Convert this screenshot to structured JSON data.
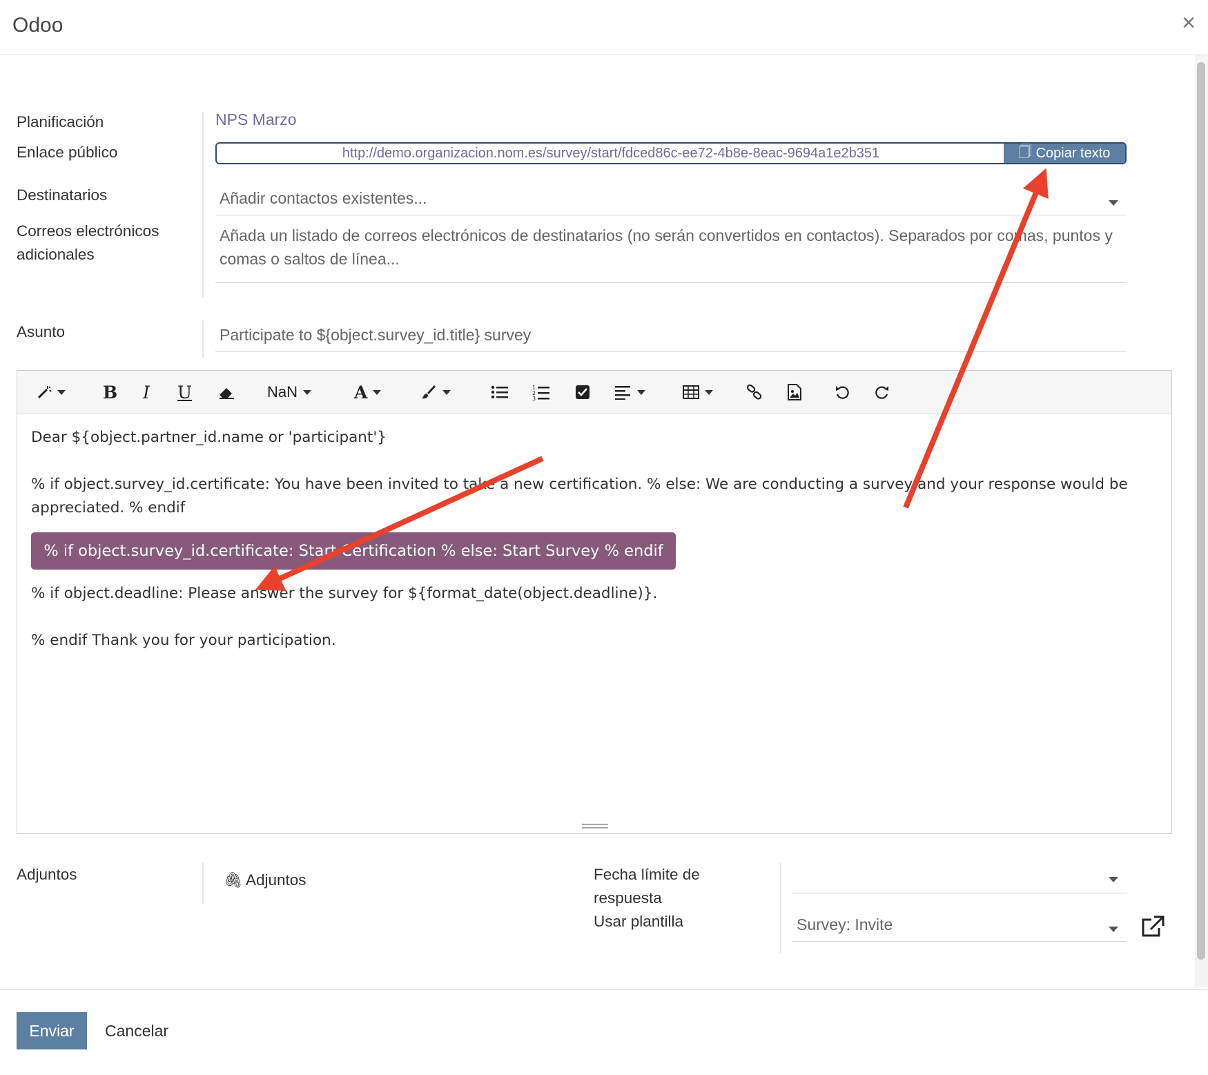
{
  "dialog": {
    "title": "Odoo",
    "close_glyph": "×"
  },
  "form": {
    "planning_label": "Planificación",
    "planning_value": "NPS Marzo",
    "public_link_label": "Enlace público",
    "public_link_url": "http://demo.organizacion.nom.es/survey/start/fdced86c-ee72-4b8e-8eac-9694a1e2b351",
    "copy_button_label": "Copiar texto",
    "copy_icon": "copy-icon",
    "recipients_label": "Destinatarios",
    "recipients_placeholder": "Añadir contactos existentes...",
    "emails_label": "Correos electrónicos adicionales",
    "emails_placeholder": "Añada un listado de correos electrónicos de destinatarios (no serán convertidos en contactos). Separados por comas, puntos y comas o saltos de línea...",
    "subject_label": "Asunto",
    "subject_value": "Participate to ${object.survey_id.title} survey"
  },
  "toolbar": {
    "font_size_label": "NaN",
    "bold": "B",
    "italic": "I",
    "underline": "U",
    "font_color": "A",
    "icons": [
      "magic-wand-icon",
      "bold-icon",
      "italic-icon",
      "underline-icon",
      "eraser-icon",
      "font-size-icon",
      "font-color-icon",
      "brush-icon",
      "bullet-list-icon",
      "numbered-list-icon",
      "checklist-icon",
      "align-icon",
      "table-icon",
      "link-icon",
      "image-icon",
      "undo-icon",
      "redo-icon"
    ]
  },
  "body": {
    "line1": "Dear ${object.partner_id.name or 'participant'}",
    "line2": "% if object.survey_id.certificate: You have been invited to take a new certification. % else: We are conducting a survey and your response would be appreciated. % endif",
    "button": "% if object.survey_id.certificate: Start Certification % else: Start Survey % endif",
    "line3": "% if object.deadline: Please answer the survey for ${format_date(object.deadline)}.",
    "line4": "% endif Thank you for your participation."
  },
  "bottom": {
    "attachments_label": "Adjuntos",
    "attachments_button": "Adjuntos",
    "deadline_label": "Fecha límite de respuesta",
    "template_label": "Usar plantilla",
    "deadline_value": "",
    "template_value": "Survey: Invite"
  },
  "footer": {
    "send_label": "Enviar",
    "cancel_label": "Cancelar"
  },
  "colors": {
    "accent": "#5c7fa3",
    "pill": "#875a7b",
    "link": "#6f6ba1",
    "annotation_arrow": "#e8412c"
  }
}
